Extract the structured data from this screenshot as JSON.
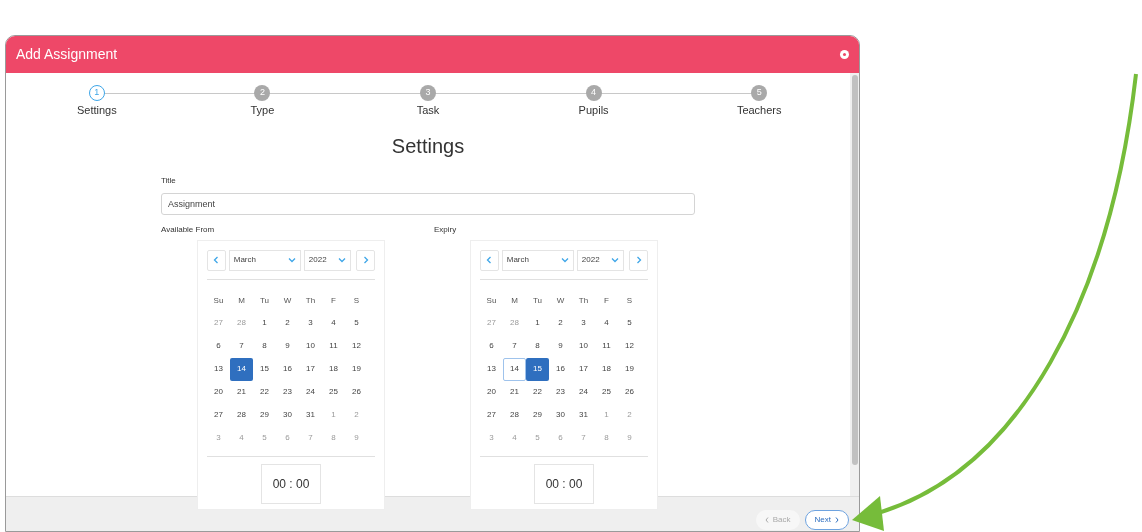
{
  "dialog": {
    "title": "Add Assignment"
  },
  "steps": [
    {
      "number": "1",
      "label": "Settings",
      "selected": true
    },
    {
      "number": "2",
      "label": "Type",
      "selected": false
    },
    {
      "number": "3",
      "label": "Task",
      "selected": false
    },
    {
      "number": "4",
      "label": "Pupils",
      "selected": false
    },
    {
      "number": "5",
      "label": "Teachers",
      "selected": false
    }
  ],
  "heading": "Settings",
  "title_field": {
    "label": "Title",
    "value": "Assignment"
  },
  "calendars": [
    {
      "label": "Available From",
      "month": "March",
      "year": "2022",
      "weekdays": [
        "Su",
        "M",
        "Tu",
        "W",
        "Th",
        "F",
        "S"
      ],
      "time": "00 : 00",
      "days": [
        {
          "day": "27",
          "outside": true,
          "selected": false,
          "outlined": false
        },
        {
          "day": "28",
          "outside": true,
          "selected": false,
          "outlined": false
        },
        {
          "day": "1",
          "outside": false,
          "selected": false,
          "outlined": false
        },
        {
          "day": "2",
          "outside": false,
          "selected": false,
          "outlined": false
        },
        {
          "day": "3",
          "outside": false,
          "selected": false,
          "outlined": false
        },
        {
          "day": "4",
          "outside": false,
          "selected": false,
          "outlined": false
        },
        {
          "day": "5",
          "outside": false,
          "selected": false,
          "outlined": false
        },
        {
          "day": "6",
          "outside": false,
          "selected": false,
          "outlined": false
        },
        {
          "day": "7",
          "outside": false,
          "selected": false,
          "outlined": false
        },
        {
          "day": "8",
          "outside": false,
          "selected": false,
          "outlined": false
        },
        {
          "day": "9",
          "outside": false,
          "selected": false,
          "outlined": false
        },
        {
          "day": "10",
          "outside": false,
          "selected": false,
          "outlined": false
        },
        {
          "day": "11",
          "outside": false,
          "selected": false,
          "outlined": false
        },
        {
          "day": "12",
          "outside": false,
          "selected": false,
          "outlined": false
        },
        {
          "day": "13",
          "outside": false,
          "selected": false,
          "outlined": false
        },
        {
          "day": "14",
          "outside": false,
          "selected": true,
          "outlined": false
        },
        {
          "day": "15",
          "outside": false,
          "selected": false,
          "outlined": false
        },
        {
          "day": "16",
          "outside": false,
          "selected": false,
          "outlined": false
        },
        {
          "day": "17",
          "outside": false,
          "selected": false,
          "outlined": false
        },
        {
          "day": "18",
          "outside": false,
          "selected": false,
          "outlined": false
        },
        {
          "day": "19",
          "outside": false,
          "selected": false,
          "outlined": false
        },
        {
          "day": "20",
          "outside": false,
          "selected": false,
          "outlined": false
        },
        {
          "day": "21",
          "outside": false,
          "selected": false,
          "outlined": false
        },
        {
          "day": "22",
          "outside": false,
          "selected": false,
          "outlined": false
        },
        {
          "day": "23",
          "outside": false,
          "selected": false,
          "outlined": false
        },
        {
          "day": "24",
          "outside": false,
          "selected": false,
          "outlined": false
        },
        {
          "day": "25",
          "outside": false,
          "selected": false,
          "outlined": false
        },
        {
          "day": "26",
          "outside": false,
          "selected": false,
          "outlined": false
        },
        {
          "day": "27",
          "outside": false,
          "selected": false,
          "outlined": false
        },
        {
          "day": "28",
          "outside": false,
          "selected": false,
          "outlined": false
        },
        {
          "day": "29",
          "outside": false,
          "selected": false,
          "outlined": false
        },
        {
          "day": "30",
          "outside": false,
          "selected": false,
          "outlined": false
        },
        {
          "day": "31",
          "outside": false,
          "selected": false,
          "outlined": false
        },
        {
          "day": "1",
          "outside": true,
          "selected": false,
          "outlined": false
        },
        {
          "day": "2",
          "outside": true,
          "selected": false,
          "outlined": false
        },
        {
          "day": "3",
          "outside": true,
          "selected": false,
          "outlined": false
        },
        {
          "day": "4",
          "outside": true,
          "selected": false,
          "outlined": false
        },
        {
          "day": "5",
          "outside": true,
          "selected": false,
          "outlined": false
        },
        {
          "day": "6",
          "outside": true,
          "selected": false,
          "outlined": false
        },
        {
          "day": "7",
          "outside": true,
          "selected": false,
          "outlined": false
        },
        {
          "day": "8",
          "outside": true,
          "selected": false,
          "outlined": false
        },
        {
          "day": "9",
          "outside": true,
          "selected": false,
          "outlined": false
        }
      ]
    },
    {
      "label": "Expiry",
      "month": "March",
      "year": "2022",
      "weekdays": [
        "Su",
        "M",
        "Tu",
        "W",
        "Th",
        "F",
        "S"
      ],
      "time": "00 : 00",
      "days": [
        {
          "day": "27",
          "outside": true,
          "selected": false,
          "outlined": false
        },
        {
          "day": "28",
          "outside": true,
          "selected": false,
          "outlined": false
        },
        {
          "day": "1",
          "outside": false,
          "selected": false,
          "outlined": false
        },
        {
          "day": "2",
          "outside": false,
          "selected": false,
          "outlined": false
        },
        {
          "day": "3",
          "outside": false,
          "selected": false,
          "outlined": false
        },
        {
          "day": "4",
          "outside": false,
          "selected": false,
          "outlined": false
        },
        {
          "day": "5",
          "outside": false,
          "selected": false,
          "outlined": false
        },
        {
          "day": "6",
          "outside": false,
          "selected": false,
          "outlined": false
        },
        {
          "day": "7",
          "outside": false,
          "selected": false,
          "outlined": false
        },
        {
          "day": "8",
          "outside": false,
          "selected": false,
          "outlined": false
        },
        {
          "day": "9",
          "outside": false,
          "selected": false,
          "outlined": false
        },
        {
          "day": "10",
          "outside": false,
          "selected": false,
          "outlined": false
        },
        {
          "day": "11",
          "outside": false,
          "selected": false,
          "outlined": false
        },
        {
          "day": "12",
          "outside": false,
          "selected": false,
          "outlined": false
        },
        {
          "day": "13",
          "outside": false,
          "selected": false,
          "outlined": false
        },
        {
          "day": "14",
          "outside": false,
          "selected": false,
          "outlined": true
        },
        {
          "day": "15",
          "outside": false,
          "selected": true,
          "outlined": false
        },
        {
          "day": "16",
          "outside": false,
          "selected": false,
          "outlined": false
        },
        {
          "day": "17",
          "outside": false,
          "selected": false,
          "outlined": false
        },
        {
          "day": "18",
          "outside": false,
          "selected": false,
          "outlined": false
        },
        {
          "day": "19",
          "outside": false,
          "selected": false,
          "outlined": false
        },
        {
          "day": "20",
          "outside": false,
          "selected": false,
          "outlined": false
        },
        {
          "day": "21",
          "outside": false,
          "selected": false,
          "outlined": false
        },
        {
          "day": "22",
          "outside": false,
          "selected": false,
          "outlined": false
        },
        {
          "day": "23",
          "outside": false,
          "selected": false,
          "outlined": false
        },
        {
          "day": "24",
          "outside": false,
          "selected": false,
          "outlined": false
        },
        {
          "day": "25",
          "outside": false,
          "selected": false,
          "outlined": false
        },
        {
          "day": "26",
          "outside": false,
          "selected": false,
          "outlined": false
        },
        {
          "day": "27",
          "outside": false,
          "selected": false,
          "outlined": false
        },
        {
          "day": "28",
          "outside": false,
          "selected": false,
          "outlined": false
        },
        {
          "day": "29",
          "outside": false,
          "selected": false,
          "outlined": false
        },
        {
          "day": "30",
          "outside": false,
          "selected": false,
          "outlined": false
        },
        {
          "day": "31",
          "outside": false,
          "selected": false,
          "outlined": false
        },
        {
          "day": "1",
          "outside": true,
          "selected": false,
          "outlined": false
        },
        {
          "day": "2",
          "outside": true,
          "selected": false,
          "outlined": false
        },
        {
          "day": "3",
          "outside": true,
          "selected": false,
          "outlined": false
        },
        {
          "day": "4",
          "outside": true,
          "selected": false,
          "outlined": false
        },
        {
          "day": "5",
          "outside": true,
          "selected": false,
          "outlined": false
        },
        {
          "day": "6",
          "outside": true,
          "selected": false,
          "outlined": false
        },
        {
          "day": "7",
          "outside": true,
          "selected": false,
          "outlined": false
        },
        {
          "day": "8",
          "outside": true,
          "selected": false,
          "outlined": false
        },
        {
          "day": "9",
          "outside": true,
          "selected": false,
          "outlined": false
        }
      ]
    }
  ],
  "footer_buttons": [
    {
      "label": "Back",
      "kind": "back",
      "disabled": true
    },
    {
      "label": "Next",
      "kind": "next",
      "disabled": false
    }
  ]
}
